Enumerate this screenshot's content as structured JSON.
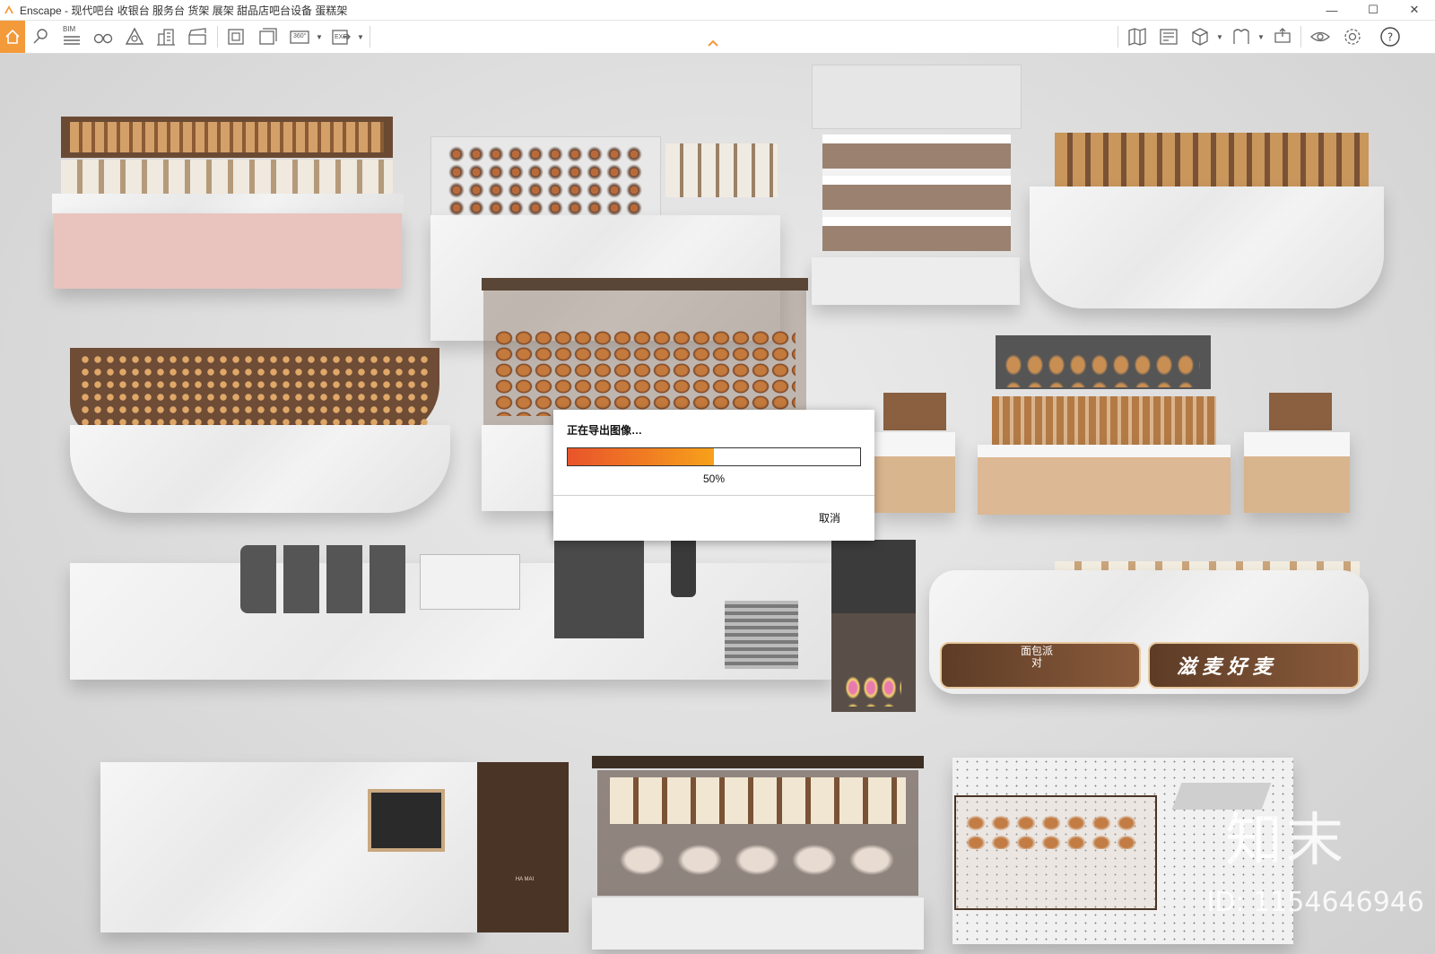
{
  "window": {
    "title": "Enscape - 现代吧台 收银台 服务台 货架 展架 甜品店吧台设备 蛋糕架",
    "controls": {
      "minimize": "—",
      "maximize": "☐",
      "close": "✕"
    }
  },
  "toolbar": {
    "bim_label": "BIM",
    "icons": [
      "home-icon",
      "location-icon",
      "bim-icon",
      "binoculars-icon",
      "perspective-icon",
      "buildings-icon",
      "clapper-icon",
      "screenshot-icon",
      "batch-render-icon",
      "panorama-icon",
      "exe-export-icon",
      "map-icon",
      "asset-library-icon",
      "cube-icon",
      "material-icon",
      "upload-icon",
      "visual-settings-icon",
      "settings-icon",
      "help-icon"
    ],
    "panorama_label": "360°",
    "exe_label": "EXE"
  },
  "scene": {
    "sign_left": "面包派对",
    "sign_right": "滋 麦 好 麦",
    "cabinet_brand": "HA MAI"
  },
  "watermark": {
    "brand": "知末",
    "id": "ID: 1154646946"
  },
  "dialog": {
    "title": "正在导出图像…",
    "progress": 0.5,
    "progress_text": "50%",
    "cancel_label": "取消"
  },
  "colors": {
    "accent": "#f39a3a",
    "progress_start": "#e8542a",
    "progress_end": "#f7a11a"
  }
}
